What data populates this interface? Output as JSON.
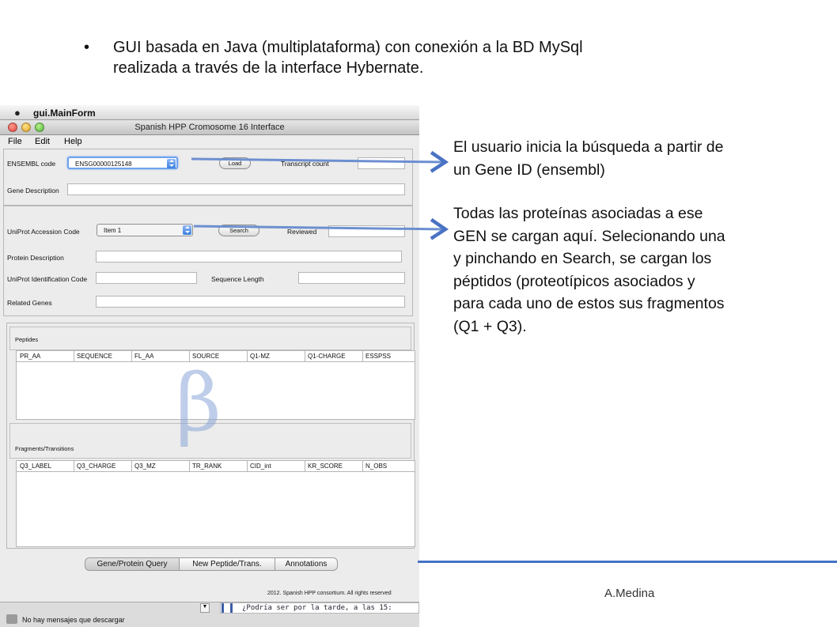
{
  "slide": {
    "bullet": "•",
    "bullet_text_line1": "GUI basada en Java (multiplataforma) con conexión a la BD MySql",
    "bullet_text_line2": "realizada a través de la interface Hybernate.",
    "note1_line1": "El usuario inicia la búsqueda a partir de",
    "note1_line2": "un Gene ID (ensembl)",
    "note2_lines": [
      "Todas las proteínas asociadas a ese",
      "GEN se cargan aquí. Selecionando una",
      "y pinchando en Search, se cargan los",
      "péptidos (proteotípicos asociados y",
      "para cada uno de estos sus fragmentos",
      "(Q1 + Q3)."
    ],
    "author": "A.Medina",
    "arrow_color": "#4a72c4",
    "rule_color": "#4472c4"
  },
  "app": {
    "mac_app_name": "gui.MainForm",
    "window_title": "Spanish HPP Cromosome 16 Interface",
    "menu": [
      "File",
      "Edit",
      "Help"
    ],
    "gene_panel": {
      "ensembl_label": "ENSEMBL code",
      "ensembl_value": "ENSG00000125148",
      "load_button": "Load",
      "transcript_label": "Transcript count",
      "gene_desc_label": "Gene Description"
    },
    "protein_panel": {
      "uniprot_label": "UniProt Accession Code",
      "uniprot_value": "Item 1",
      "search_button": "Search",
      "reviewed_label": "Reviewed",
      "protein_desc_label": "Protein Description",
      "uniprot_id_label": "UniProt Identification Code",
      "seq_length_label": "Sequence Length",
      "related_genes_label": "Related Genes"
    },
    "peptides": {
      "label": "Peptides",
      "columns": [
        "PR_AA",
        "SEQUENCE",
        "FL_AA",
        "SOURCE",
        "Q1-MZ",
        "Q1-CHARGE",
        "ESSPSS"
      ]
    },
    "fragments": {
      "label": "Fragments/Transitions",
      "columns": [
        "Q3_LABEL",
        "Q3_CHARGE",
        "Q3_MZ",
        "TR_RANK",
        "CID_int",
        "KR_SCORE",
        "N_OBS"
      ]
    },
    "watermark": "β",
    "tabs": [
      "Gene/Protein Query",
      "New Peptide/Trans.",
      "Annotations"
    ],
    "footer": "2012. Spanish HPP consortium. All rights reserved",
    "status_message": "No hay mensajes que descargar",
    "status_button": "▼",
    "chat_text": "¿Podría ser por la tarde, a las 15:"
  }
}
